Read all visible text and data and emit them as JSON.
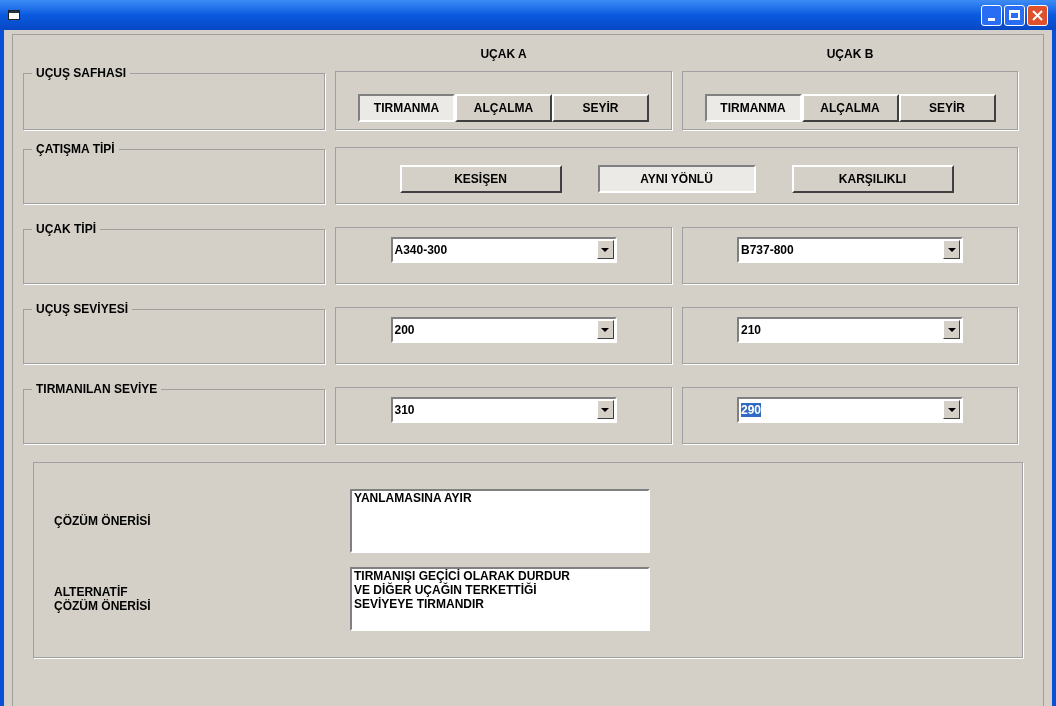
{
  "columns": [
    {
      "label": "UÇAK A"
    },
    {
      "label": "UÇAK B"
    }
  ],
  "flight_phase": {
    "label": "UÇUŞ SAFHASI",
    "aircraft": [
      {
        "buttons": [
          {
            "label": "TIRMANMA",
            "selected": true
          },
          {
            "label": "ALÇALMA",
            "selected": false
          },
          {
            "label": "SEYİR",
            "selected": false
          }
        ]
      },
      {
        "buttons": [
          {
            "label": "TIRMANMA",
            "selected": true
          },
          {
            "label": "ALÇALMA",
            "selected": false
          },
          {
            "label": "SEYİR",
            "selected": false
          }
        ]
      }
    ]
  },
  "conflict_type": {
    "label": "ÇATIŞMA TİPİ",
    "buttons": [
      {
        "label": "KESİŞEN",
        "selected": false
      },
      {
        "label": "AYNI YÖNLÜ",
        "selected": true
      },
      {
        "label": "KARŞILIKLI",
        "selected": false
      }
    ]
  },
  "dropdown_rows": [
    {
      "label": "UÇAK TİPİ",
      "values": [
        {
          "value": "A340-300",
          "highlighted": false
        },
        {
          "value": "B737-800",
          "highlighted": false
        }
      ]
    },
    {
      "label": "UÇUŞ SEVİYESİ",
      "values": [
        {
          "value": "200",
          "highlighted": false
        },
        {
          "value": "210",
          "highlighted": false
        }
      ]
    },
    {
      "label": "TIRMANILAN SEVİYE",
      "values": [
        {
          "value": "310",
          "highlighted": false
        },
        {
          "value": "290",
          "highlighted": true
        }
      ]
    }
  ],
  "solution": {
    "fields": [
      {
        "label": "ÇÖZÜM ÖNERİSİ",
        "value": "YANLAMASINA AYIR"
      },
      {
        "label": "ALTERNATİF\nÇÖZÜM ÖNERİSİ",
        "value": "TIRMANIŞI GEÇİCİ OLARAK DURDUR\nVE DİĞER UÇAĞIN TERKETTİĞİ\nSEVİYEYE TIRMANDIR"
      }
    ]
  }
}
